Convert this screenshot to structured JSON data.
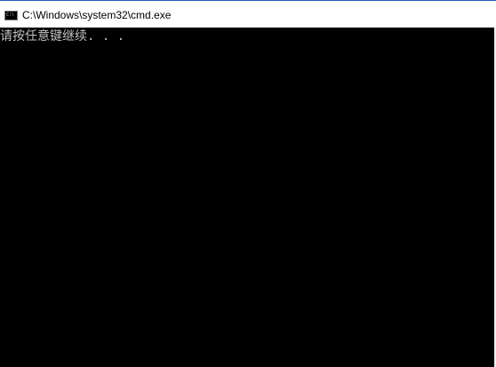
{
  "window": {
    "title": "C:\\Windows\\system32\\cmd.exe",
    "icon": "cmd-console-icon",
    "icon_glyph": "C:\\"
  },
  "console": {
    "lines": [
      "请按任意键继续. . ."
    ]
  },
  "colors": {
    "titlebar_bg": "#ffffff",
    "console_bg": "#000000",
    "console_text": "#c0c0c0"
  }
}
